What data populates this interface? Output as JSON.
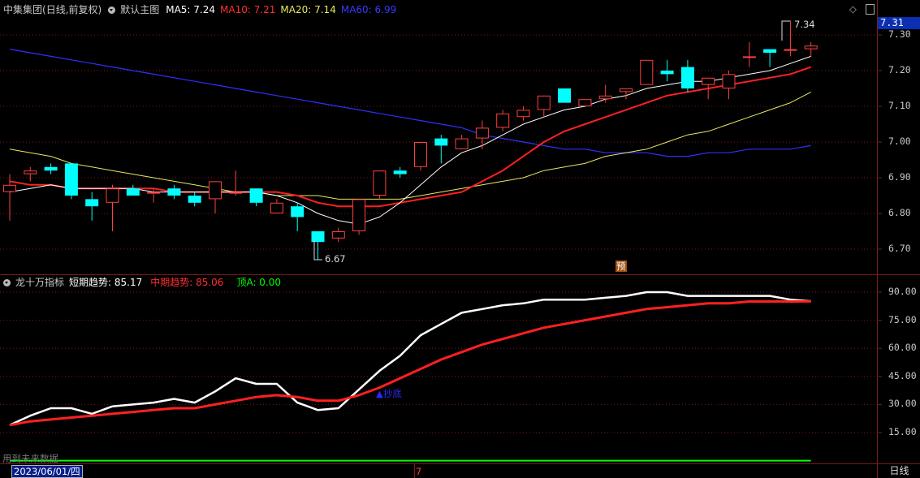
{
  "header_price": {
    "stock": "中集集团",
    "period": "(日线,前复权)",
    "main_chart": "默认主图",
    "ma5": "MA5: 7.24",
    "ma10": "MA10: 7.21",
    "ma20": "MA20: 7.14",
    "ma60": "MA60: 6.99"
  },
  "header_indicator": {
    "name": "龙十万指标",
    "short": "短期趋势: 85.17",
    "mid": "中期趋势: 85.06",
    "top": "顶A: 0.00"
  },
  "labels": {
    "current_price": "7.31",
    "high_mark": "7.34",
    "low_mark": "6.67",
    "pre_badge": "预",
    "signal": "▲抄底",
    "future_data": "用到未来数据",
    "date": "2023/06/01/四",
    "month_mark": "7",
    "period_tab": "日线"
  },
  "colors": {
    "up": "#ff4040",
    "down": "#00ffff",
    "ma5": "#ffffff",
    "ma10": "#ff2020",
    "ma20": "#e8e860",
    "ma60": "#3030ff",
    "grid": "#7a1a1a",
    "short": "#ffffff",
    "mid": "#ff2020",
    "topA": "#00ff00"
  },
  "chart_data": [
    {
      "type": "candlestick",
      "ylim": [
        6.62,
        7.36
      ],
      "yticks": [
        "7.30",
        "7.20",
        "7.10",
        "7.00",
        "6.90",
        "6.80",
        "6.70"
      ],
      "candles": [
        [
          6.86,
          6.91,
          6.78,
          6.88
        ],
        [
          6.91,
          6.93,
          6.89,
          6.92
        ],
        [
          6.93,
          6.94,
          6.91,
          6.92
        ],
        [
          6.94,
          6.94,
          6.84,
          6.85
        ],
        [
          6.84,
          6.86,
          6.78,
          6.82
        ],
        [
          6.83,
          6.88,
          6.75,
          6.87
        ],
        [
          6.87,
          6.88,
          6.85,
          6.85
        ],
        [
          6.86,
          6.87,
          6.83,
          6.86
        ],
        [
          6.87,
          6.88,
          6.84,
          6.85
        ],
        [
          6.85,
          6.86,
          6.82,
          6.83
        ],
        [
          6.84,
          6.89,
          6.8,
          6.89
        ],
        [
          6.86,
          6.92,
          6.85,
          6.86
        ],
        [
          6.87,
          6.87,
          6.82,
          6.83
        ],
        [
          6.8,
          6.84,
          6.8,
          6.83
        ],
        [
          6.82,
          6.83,
          6.75,
          6.79
        ],
        [
          6.75,
          6.75,
          6.67,
          6.72
        ],
        [
          6.73,
          6.76,
          6.72,
          6.75
        ],
        [
          6.75,
          6.84,
          6.74,
          6.84
        ],
        [
          6.85,
          6.92,
          6.84,
          6.92
        ],
        [
          6.92,
          6.93,
          6.9,
          6.91
        ],
        [
          6.93,
          7.0,
          6.92,
          7.0
        ],
        [
          7.01,
          7.02,
          6.94,
          6.99
        ],
        [
          6.98,
          7.02,
          6.98,
          7.01
        ],
        [
          7.01,
          7.06,
          6.98,
          7.04
        ],
        [
          7.04,
          7.09,
          7.03,
          7.08
        ],
        [
          7.07,
          7.1,
          7.06,
          7.09
        ],
        [
          7.09,
          7.13,
          7.07,
          7.13
        ],
        [
          7.15,
          7.15,
          7.11,
          7.11
        ],
        [
          7.1,
          7.12,
          7.1,
          7.12
        ],
        [
          7.12,
          7.16,
          7.11,
          7.13
        ],
        [
          7.14,
          7.15,
          7.12,
          7.15
        ],
        [
          7.16,
          7.23,
          7.16,
          7.23
        ],
        [
          7.2,
          7.23,
          7.17,
          7.19
        ],
        [
          7.21,
          7.23,
          7.14,
          7.15
        ],
        [
          7.16,
          7.18,
          7.12,
          7.18
        ],
        [
          7.15,
          7.2,
          7.12,
          7.19
        ],
        [
          7.24,
          7.28,
          7.21,
          7.24
        ],
        [
          7.26,
          7.26,
          7.21,
          7.25
        ],
        [
          7.26,
          7.34,
          7.24,
          7.26
        ],
        [
          7.26,
          7.28,
          7.24,
          7.27
        ]
      ],
      "ma5": [
        6.86,
        6.87,
        6.88,
        6.87,
        6.87,
        6.87,
        6.87,
        6.86,
        6.86,
        6.86,
        6.86,
        6.86,
        6.86,
        6.85,
        6.83,
        6.8,
        6.78,
        6.77,
        6.79,
        6.83,
        6.88,
        6.93,
        6.97,
        6.99,
        7.02,
        7.05,
        7.07,
        7.09,
        7.1,
        7.12,
        7.13,
        7.15,
        7.16,
        7.17,
        7.17,
        7.18,
        7.19,
        7.2,
        7.22,
        7.24
      ],
      "ma10": [
        6.89,
        6.88,
        6.88,
        6.87,
        6.87,
        6.87,
        6.87,
        6.87,
        6.86,
        6.86,
        6.86,
        6.86,
        6.86,
        6.86,
        6.85,
        6.83,
        6.82,
        6.82,
        6.82,
        6.83,
        6.84,
        6.85,
        6.86,
        6.89,
        6.92,
        6.96,
        7.0,
        7.03,
        7.05,
        7.07,
        7.09,
        7.11,
        7.13,
        7.14,
        7.15,
        7.16,
        7.17,
        7.18,
        7.19,
        7.21
      ],
      "ma20": [
        6.98,
        6.97,
        6.96,
        6.94,
        6.93,
        6.92,
        6.91,
        6.9,
        6.89,
        6.88,
        6.87,
        6.86,
        6.86,
        6.85,
        6.85,
        6.85,
        6.84,
        6.84,
        6.84,
        6.84,
        6.85,
        6.86,
        6.87,
        6.88,
        6.89,
        6.9,
        6.92,
        6.93,
        6.94,
        6.96,
        6.97,
        6.98,
        7.0,
        7.02,
        7.03,
        7.05,
        7.07,
        7.09,
        7.11,
        7.14
      ],
      "ma60": [
        7.26,
        7.25,
        7.24,
        7.23,
        7.22,
        7.21,
        7.2,
        7.19,
        7.18,
        7.17,
        7.16,
        7.15,
        7.14,
        7.13,
        7.12,
        7.11,
        7.1,
        7.09,
        7.08,
        7.07,
        7.06,
        7.05,
        7.04,
        7.02,
        7.01,
        7.0,
        6.99,
        6.98,
        6.98,
        6.97,
        6.97,
        6.97,
        6.96,
        6.96,
        6.97,
        6.97,
        6.98,
        6.98,
        6.98,
        6.99
      ]
    },
    {
      "type": "line",
      "ylim": [
        8,
        96
      ],
      "yticks": [
        "90.00",
        "75.00",
        "60.00",
        "45.00",
        "30.00",
        "15.00"
      ],
      "series": [
        {
          "name": "短期趋势",
          "values": [
            19,
            24,
            28,
            28,
            25,
            29,
            30,
            31,
            33,
            31,
            37,
            44,
            41,
            41,
            31,
            27,
            28,
            38,
            48,
            56,
            67,
            73,
            79,
            81,
            83,
            84,
            86,
            86,
            86,
            87,
            88,
            90,
            90,
            88,
            88,
            88,
            88,
            88,
            86,
            85.17
          ]
        },
        {
          "name": "中期趋势",
          "values": [
            19,
            21,
            22,
            23,
            24,
            25,
            26,
            27,
            28,
            28,
            30,
            32,
            34,
            35,
            34,
            32,
            32,
            35,
            39,
            44,
            49,
            54,
            58,
            62,
            65,
            68,
            71,
            73,
            75,
            77,
            79,
            81,
            82,
            83,
            84,
            84,
            85,
            85,
            85,
            85.06
          ]
        },
        {
          "name": "顶A",
          "values": [
            0,
            0,
            0,
            0,
            0,
            0,
            0,
            0,
            0,
            0,
            0,
            0,
            0,
            0,
            0,
            0,
            0,
            0,
            0,
            0,
            0,
            0,
            0,
            0,
            0,
            0,
            0,
            0,
            0,
            0,
            0,
            0,
            0,
            0,
            0,
            0,
            0,
            0,
            0,
            0
          ]
        }
      ]
    }
  ]
}
